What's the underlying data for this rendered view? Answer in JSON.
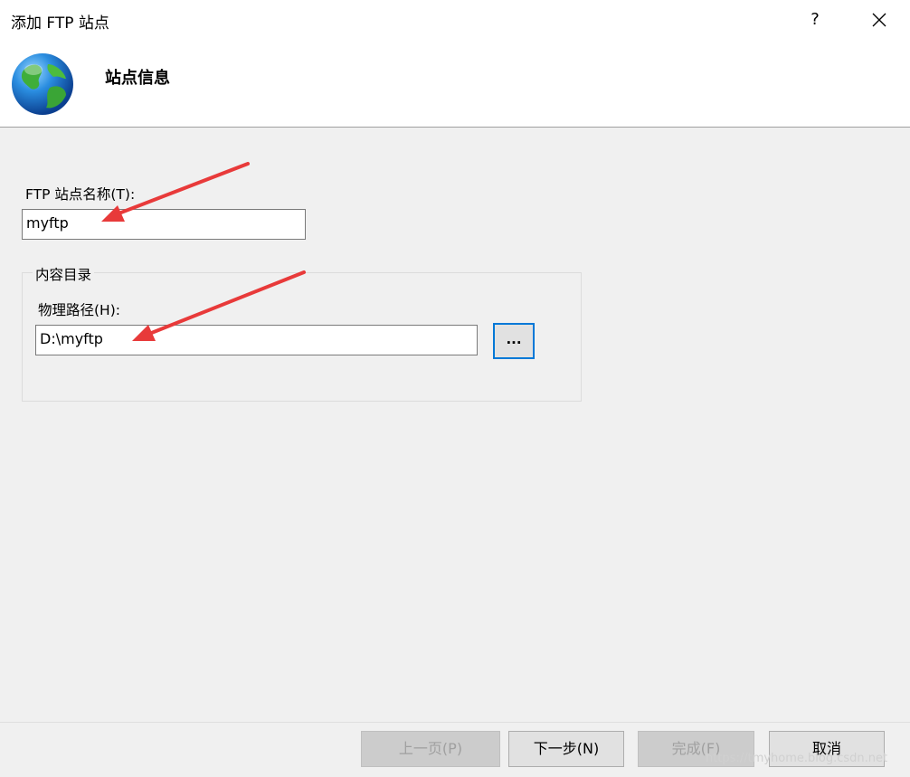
{
  "window": {
    "title": "添加 FTP 站点",
    "help_label": "?"
  },
  "header": {
    "title": "站点信息",
    "icon": "globe-icon"
  },
  "site_name": {
    "label": "FTP 站点名称(T):",
    "value": "myftp"
  },
  "content_directory": {
    "group_label": "内容目录",
    "path_label": "物理路径(H):",
    "path_value": "D:\\myftp",
    "browse_label": "..."
  },
  "footer": {
    "prev_label": "上一页(P)",
    "next_label": "下一步(N)",
    "finish_label": "完成(F)",
    "cancel_label": "取消"
  },
  "watermark": "https://tmyhome.blog.csdn.net",
  "colors": {
    "focus_border": "#0078d7",
    "annotation_arrow": "#e83a3a"
  }
}
